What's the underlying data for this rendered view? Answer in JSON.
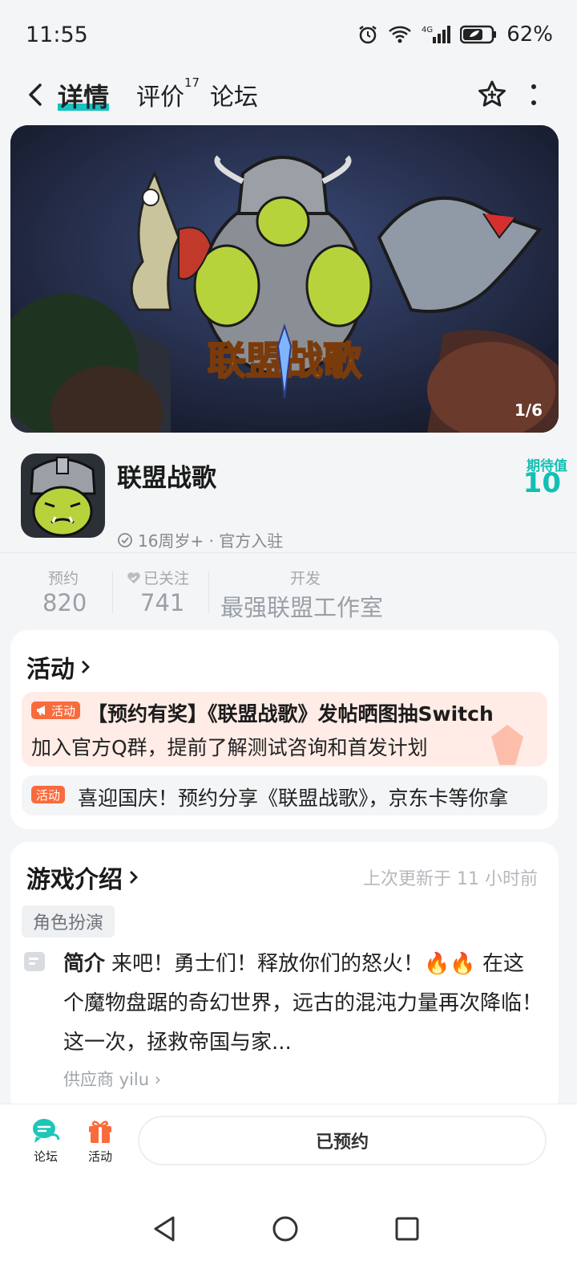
{
  "status_bar": {
    "time": "11:55",
    "battery": "62%",
    "network": "4G"
  },
  "nav": {
    "tabs": [
      {
        "label": "详情",
        "active": true
      },
      {
        "label": "评价",
        "badge": "17"
      },
      {
        "label": "论坛"
      }
    ]
  },
  "banner": {
    "counter": "1/6",
    "logo_text": "联盟战歌"
  },
  "app": {
    "name": "联盟战歌",
    "meta": "16周岁+ · 官方入驻",
    "expect_label": "期待值",
    "expect_value": "10"
  },
  "stats": [
    {
      "label": "预约",
      "value": "820"
    },
    {
      "label": "已关注",
      "value": "741"
    },
    {
      "label": "开发",
      "value": "最强联盟工作室"
    }
  ],
  "activity": {
    "title": "活动",
    "tag": "活动",
    "items": [
      {
        "title": "【预约有奖】《联盟战歌》发帖晒图抽Switch",
        "desc": "加入官方Q群，提前了解测试咨询和首发计划"
      },
      {
        "title": "喜迎国庆！预约分享《联盟战歌》，京东卡等你拿"
      }
    ]
  },
  "intro": {
    "title": "游戏介绍",
    "updated": "上次更新于 11 小时前",
    "genre": "角色扮演",
    "desc_label": "简介",
    "desc": "来吧！勇士们！释放你们的怒火！🔥🔥 在这个魔物盘踞的奇幻世界，远古的混沌力量再次降临！这一次，拯救帝国与家...",
    "supplier": "供应商 yilu"
  },
  "bottom_bar": {
    "forum_label": "论坛",
    "activity_label": "活动",
    "reserve_label": "已预约"
  },
  "colors": {
    "accent": "#16c3c3",
    "activity_orange": "#f96b3c",
    "expect_teal": "#13bfb3"
  }
}
